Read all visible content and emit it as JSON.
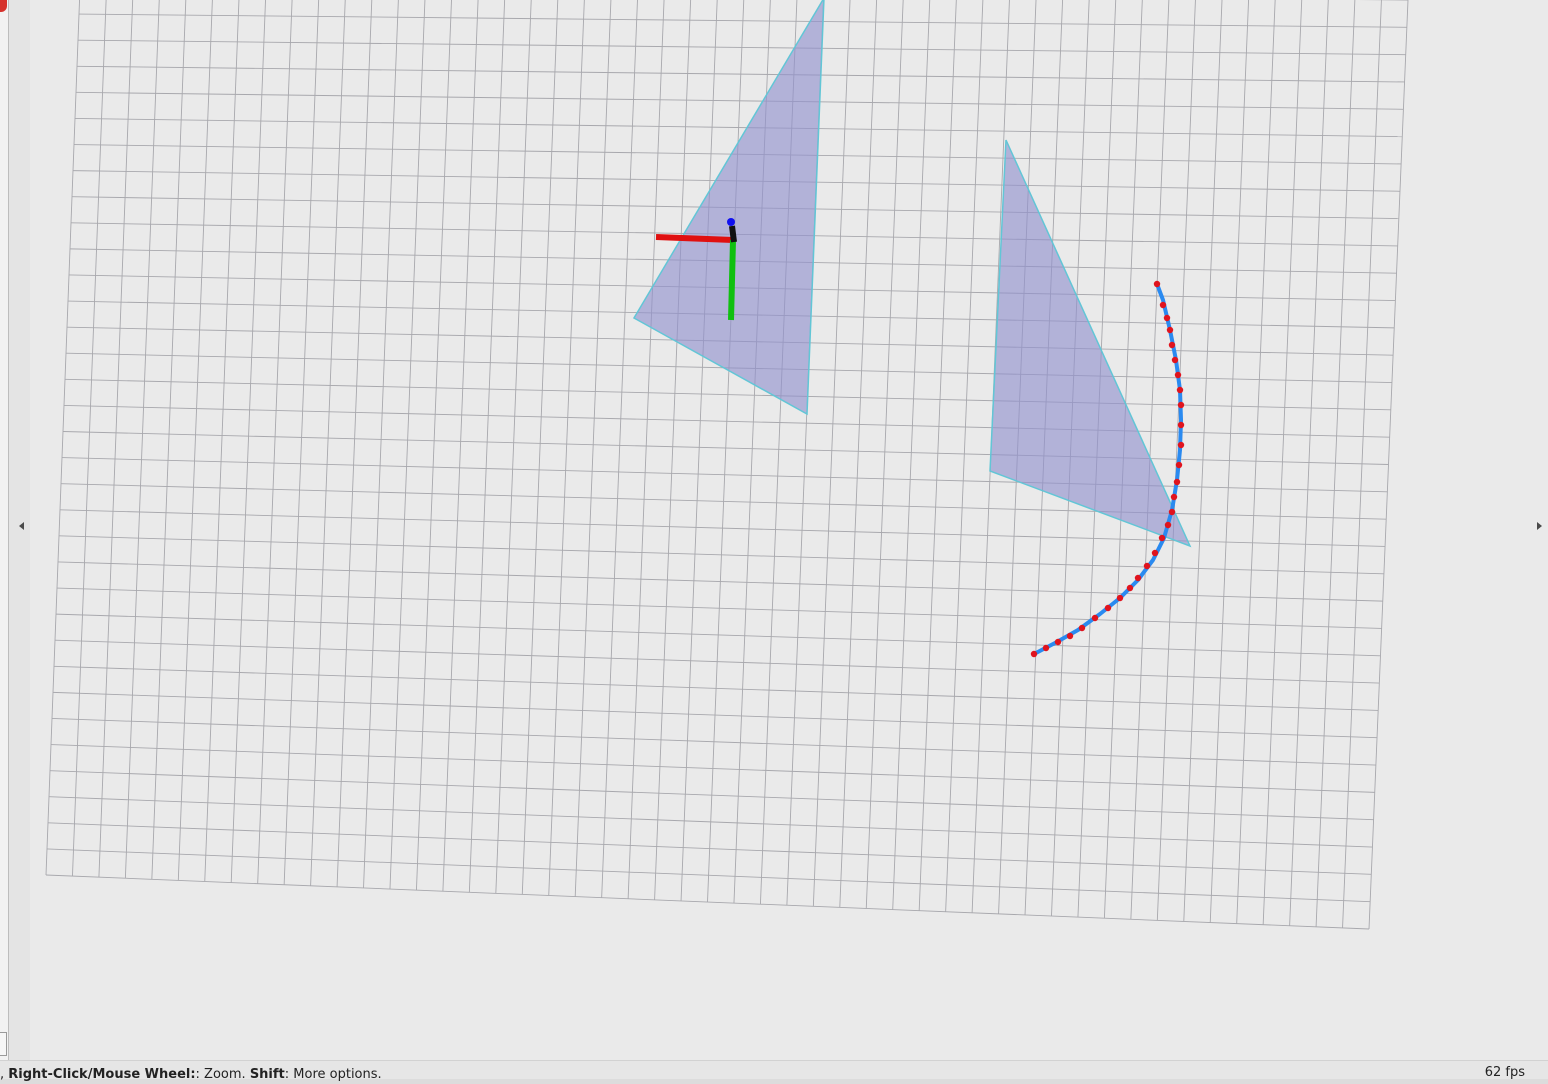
{
  "status_bar": {
    "hint_prefix": ", ",
    "hint_key_1": "Right-Click/Mouse Wheel:",
    "hint_text_1": ": Zoom. ",
    "hint_key_2": "Shift",
    "hint_text_2": ": More options.",
    "fps": "62 fps"
  },
  "scene": {
    "background_color": "#eaeaea",
    "grid_color": "#a8a8ad",
    "plane_fill": "#8f90cd",
    "plane_edge": "#62c6d6",
    "axis_colors": {
      "x": "#e01010",
      "y": "#10c010",
      "z": "#1010f0"
    },
    "path_color": "#2a8af0",
    "pose_marker_color": "#e0141e"
  },
  "icons": {
    "collapse_left": "triangle-left-icon",
    "collapse_right": "triangle-right-icon"
  }
}
